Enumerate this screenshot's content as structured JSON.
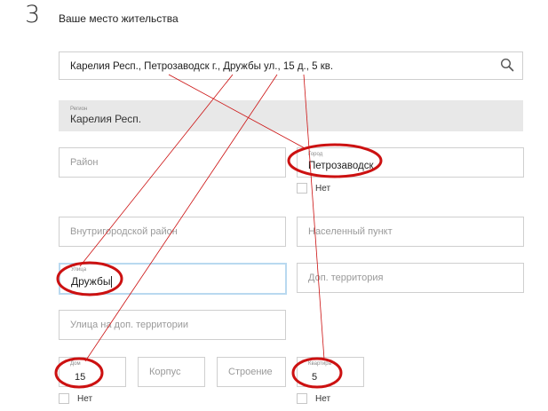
{
  "header": {
    "step_number": "3",
    "title": "Ваше место жительства"
  },
  "address_search": {
    "value": "Карелия Респ., Петрозаводск г., Дружбы ул., 15 д.,  5  кв.",
    "icon": "search-icon"
  },
  "region": {
    "label": "Регион",
    "value": "Карелия Респ."
  },
  "district": {
    "placeholder": "Район"
  },
  "city": {
    "label": "Город",
    "value": "Петрозаводск",
    "no_label": "Нет"
  },
  "intracity_district": {
    "placeholder": "Внутригородской район"
  },
  "settlement": {
    "placeholder": "Населенный пункт"
  },
  "street": {
    "label": "Улица",
    "value": "Дружбы"
  },
  "extra_territory": {
    "placeholder": "Доп. территория"
  },
  "street_extra_territory": {
    "placeholder": "Улица на доп. территории"
  },
  "house": {
    "label": "Дом",
    "value": "15",
    "no_label": "Нет"
  },
  "building": {
    "placeholder": "Корпус"
  },
  "structure": {
    "placeholder": "Строение"
  },
  "apartment": {
    "label": "Квартира",
    "value": "5",
    "no_label": "Нет"
  },
  "colors": {
    "annotation_red": "#cc1111",
    "field_border": "#cfcfcf",
    "region_bg": "#e8e8e8",
    "active_border": "#b9d9f0"
  }
}
